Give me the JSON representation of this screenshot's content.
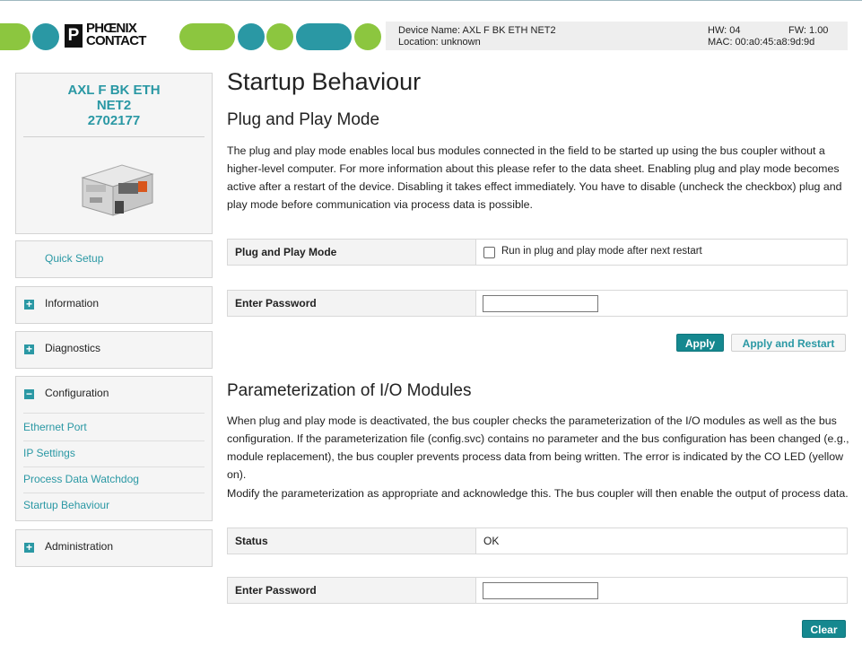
{
  "colors": {
    "teal": "#2a98a4",
    "green": "#8cc63f",
    "primary_button": "#15888f"
  },
  "brand": {
    "mark": "P",
    "line1": "PHŒNIX",
    "line2": "CONTACT"
  },
  "device": {
    "name": "Device Name: AXL F BK ETH NET2",
    "location": "Location: unknown",
    "hw": "HW: 04",
    "fw": "FW: 1.00",
    "mac": "MAC: 00:a0:45:a8:9d:9d"
  },
  "sidebar": {
    "product": {
      "line1": "AXL F BK ETH",
      "line2": "NET2",
      "line3": "2702177"
    },
    "quick_setup": "Quick Setup",
    "information": {
      "icon": "plus-icon",
      "toggle": "+",
      "label": "Information"
    },
    "diagnostics": {
      "icon": "plus-icon",
      "toggle": "+",
      "label": "Diagnostics"
    },
    "configuration": {
      "icon": "minus-icon",
      "toggle": "−",
      "label": "Configuration",
      "items": [
        "Ethernet Port",
        "IP Settings",
        "Process Data Watchdog",
        "Startup Behaviour"
      ]
    },
    "administration": {
      "icon": "plus-icon",
      "toggle": "+",
      "label": "Administration"
    }
  },
  "main": {
    "title": "Startup Behaviour",
    "pnp": {
      "heading": "Plug and Play Mode",
      "text": "The plug and play mode enables local bus modules connected in the field to be started up using the bus coupler without a higher-level computer. For more information about this please refer to the data sheet. Enabling plug and play mode becomes active after a restart of the device. Disabling it takes effect immediately. You have to disable (uncheck the checkbox) plug and play mode before communication via process data is possible.",
      "mode_label": "Plug and Play Mode",
      "checkbox_label": "Run in plug and play mode after next restart",
      "checkbox_checked": false,
      "password_label": "Enter Password",
      "password_value": "",
      "apply": "Apply",
      "apply_restart": "Apply and Restart"
    },
    "param": {
      "heading": "Parameterization of I/O Modules",
      "text1": "When plug and play mode is deactivated, the bus coupler checks the parameterization of the I/O modules as well as the bus configuration. If the parameterization file (config.svc) contains no parameter and the bus configuration has been changed (e.g., module replacement), the bus coupler prevents process data from being written. The error is indicated by the CO LED (yellow on).",
      "text2": "Modify the parameterization as appropriate and acknowledge this. The bus coupler will then enable the output of process data.",
      "status_label": "Status",
      "status_value": "OK",
      "password_label": "Enter Password",
      "password_value": "",
      "clear": "Clear"
    }
  }
}
